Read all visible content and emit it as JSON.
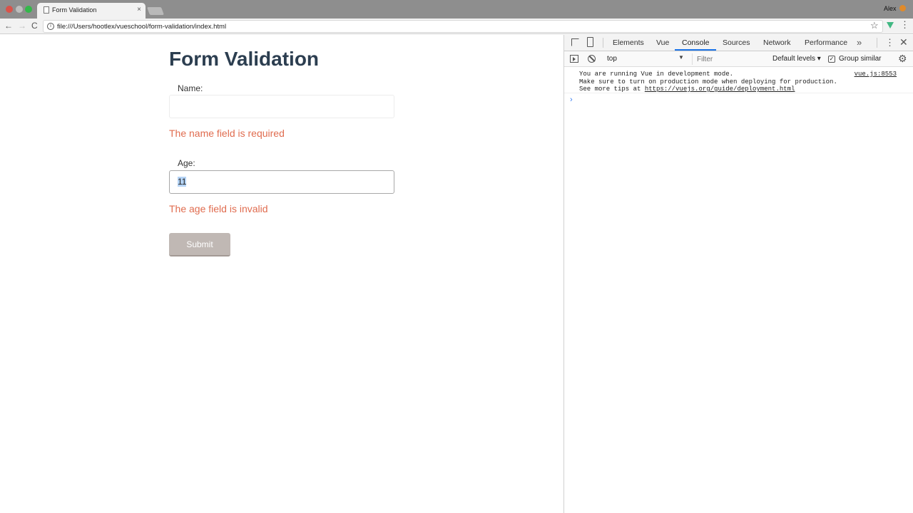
{
  "browser": {
    "tab_title": "Form Validation",
    "tab_close": "×",
    "profile_name": "Alex",
    "url": "file:///Users/hootlex/vueschool/form-validation/index.html",
    "nav_back": "←",
    "nav_forward": "→",
    "nav_reload": "C",
    "star": "☆",
    "menu": "⋮",
    "info": "i"
  },
  "page": {
    "title": "Form Validation",
    "name_label": "Name:",
    "name_value": "",
    "name_error": "The name field is required",
    "age_label": "Age:",
    "age_value": "11",
    "age_error": "The age field is invalid",
    "submit_label": "Submit"
  },
  "devtools": {
    "tabs": [
      "Elements",
      "Vue",
      "Console",
      "Sources",
      "Network",
      "Performance"
    ],
    "active_tab": "Console",
    "more_tabs": "»",
    "kebab": "⋮",
    "close": "✕",
    "context": "top",
    "context_arrow": "▼",
    "filter_placeholder": "Filter",
    "levels": "Default levels ▾",
    "group_similar_checked": true,
    "group_similar_check": "✓",
    "group_similar": "Group similar",
    "settings": "⚙",
    "console_messages": [
      {
        "line1": "You are running Vue in development mode.",
        "line2": "Make sure to turn on production mode when deploying for production.",
        "line3_prefix": "See more tips at ",
        "line3_link": "https://vuejs.org/guide/deployment.html",
        "source": "vue.js:8553"
      }
    ],
    "prompt": "›"
  },
  "colors": {
    "title": "#2c3e50",
    "error": "#e06c4f",
    "submit_bg": "#c0b8b4",
    "active_tab_underline": "#1a73e8"
  }
}
